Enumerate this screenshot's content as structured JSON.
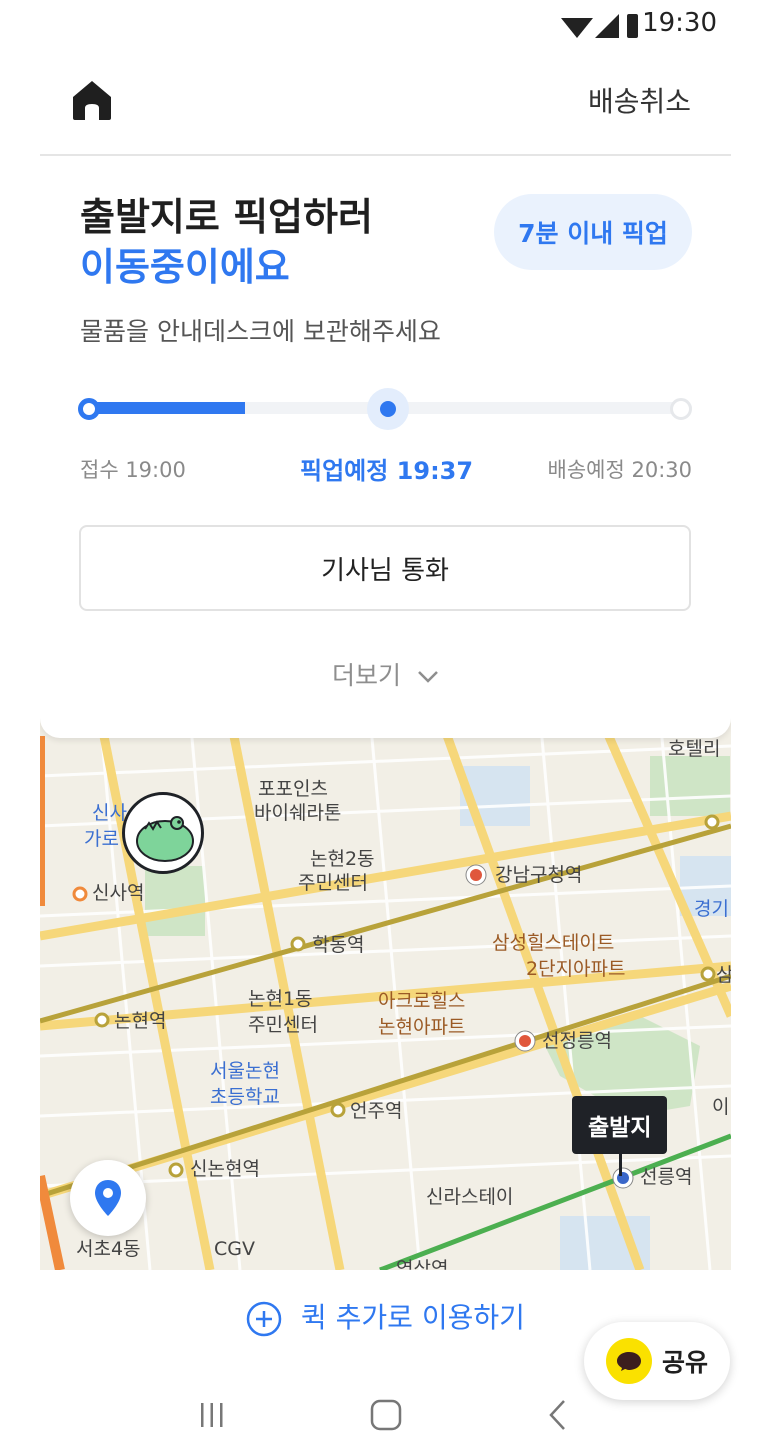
{
  "status_bar": {
    "time": "19:30"
  },
  "header": {
    "cancel_label": "배송취소"
  },
  "status": {
    "title_line1": "출발지로 픽업하러",
    "title_line2": "이동중이에요",
    "badge": "7분 이내 픽업",
    "subtitle": "물품을 안내데스크에 보관해주세요"
  },
  "progress": {
    "fraction": 0.27,
    "steps": [
      {
        "label": "접수 19:00"
      },
      {
        "label": "픽업예정 19:37"
      },
      {
        "label": "배송예정 20:30"
      }
    ]
  },
  "call_button": "기사님 통화",
  "more_label": "더보기",
  "map": {
    "pickup_pin": "출발지",
    "labels": {
      "hotel_top": "호텔리",
      "popo1": "포포인츠",
      "popo2": "바이쉐라톤",
      "sinsa_garo1": "신사",
      "sinsa_garo2": "가로",
      "nonhyeon2_1": "논현2동",
      "nonhyeon2_2": "주민센터",
      "gangnam_office": "강남구청역",
      "sinsa_station": "신사역",
      "gyeong": "경기",
      "hakdong": "학동역",
      "samsung1": "삼성힐스테이트",
      "samsung2": "2단지아파트",
      "sam": "삼",
      "nonhyeon_station": "논현역",
      "nonhyeon1_1": "논현1동",
      "nonhyeon1_2": "주민센터",
      "acro1": "아크로힐스",
      "acro2": "논현아파트",
      "seonjeongneung": "선정릉역",
      "school1": "서울논현",
      "school2": "초등학교",
      "eonju": "언주역",
      "i": "이",
      "sinnonhyeon": "신논현역",
      "silla": "신라스테이",
      "seolleung": "선릉역",
      "seocho4": "서초4동",
      "cgv": "CGV",
      "yeoksam": "역삼역"
    }
  },
  "add_link": "퀵 추가로 이용하기",
  "share_label": "공유",
  "colors": {
    "accent": "#2f78f0",
    "badge_bg": "#eaf2fd",
    "kakao_yellow": "#fae100"
  }
}
